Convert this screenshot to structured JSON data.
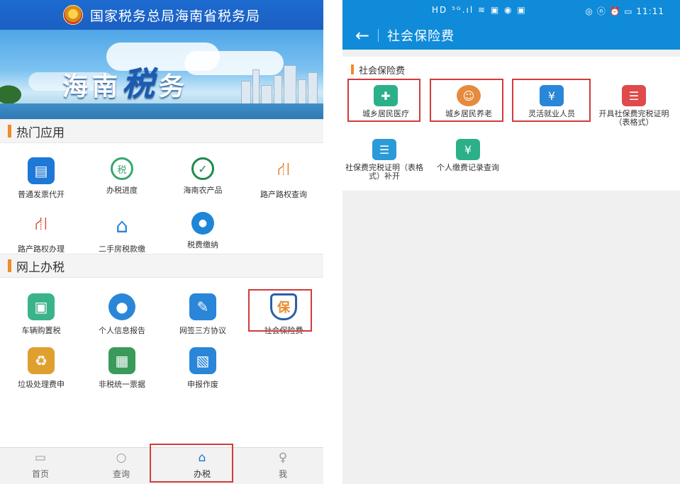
{
  "left": {
    "header_title": "国家税务总局海南省税务局",
    "banner_text_1": "海南",
    "banner_text_big": "税",
    "banner_text_2": "务",
    "section_hot": "热门应用",
    "hot_apps": [
      {
        "label": "普通发票代开",
        "icon": "invoice-icon",
        "color": "#1e78d6"
      },
      {
        "label": "办税进度",
        "icon": "tax-progress-icon",
        "color": "#3aa76d"
      },
      {
        "label": "海南农产品",
        "icon": "agri-product-icon",
        "color": "#1f8a4c"
      },
      {
        "label": "路产路权查询",
        "icon": "road-search-icon",
        "color": "#e07a2a"
      },
      {
        "label": "路产路权办理",
        "icon": "road-handle-icon",
        "color": "#d84a3a"
      },
      {
        "label": "二手房税款缴",
        "icon": "house-icon",
        "color": "#2a86d8"
      },
      {
        "label": "税费缴纳",
        "icon": "tax-pay-icon",
        "color": "#1e86d8"
      }
    ],
    "section_online": "网上办税",
    "online_apps": [
      {
        "label": "车辆购置税",
        "icon": "vehicle-tax-icon",
        "color": "#3bb38a"
      },
      {
        "label": "个人信息报告",
        "icon": "person-info-icon",
        "color": "#2a86d8"
      },
      {
        "label": "网签三方协议",
        "icon": "sign-agreement-icon",
        "color": "#2a86d8"
      },
      {
        "label": "社会保险费",
        "icon": "social-insurance-icon",
        "color": "#e98a2a"
      },
      {
        "label": "垃圾处理费申",
        "icon": "garbage-fee-icon",
        "color": "#e0a030"
      },
      {
        "label": "非税统一票据",
        "icon": "nontax-bill-icon",
        "color": "#3a9a5a"
      },
      {
        "label": "申报作废",
        "icon": "declare-void-icon",
        "color": "#2a86d8"
      }
    ],
    "social_glyph": "保",
    "tabs": [
      {
        "label": "首页",
        "icon": "home-icon"
      },
      {
        "label": "查询",
        "icon": "search-icon"
      },
      {
        "label": "办税",
        "icon": "tax-office-icon"
      },
      {
        "label": "我",
        "icon": "user-icon"
      }
    ],
    "active_tab": "办税"
  },
  "right": {
    "status_left": "HD ⁵ᴳ.ıl ≋ ▣ ◉ ▣",
    "status_right": "◎ ⓝ ⏰ ▭ 11:11",
    "back_glyph": "←",
    "title": "社会保险费",
    "panel_title": "社会保险费",
    "services": [
      {
        "label": "城乡居民医疗",
        "icon": "medical-icon",
        "color": "#2bb08a"
      },
      {
        "label": "城乡居民养老",
        "icon": "pension-icon",
        "color": "#e68a3c"
      },
      {
        "label": "灵活就业人员",
        "icon": "flexible-employment-icon",
        "color": "#2a86d8"
      },
      {
        "label": "开具社保费完税证明（表格式）",
        "icon": "certificate-icon",
        "color": "#e04a4a"
      },
      {
        "label": "社保费完税证明（表格式）补开",
        "icon": "certificate-reissue-icon",
        "color": "#2a9ad8"
      },
      {
        "label": "个人缴费记录查询",
        "icon": "payment-record-icon",
        "color": "#2bb08a"
      }
    ]
  }
}
